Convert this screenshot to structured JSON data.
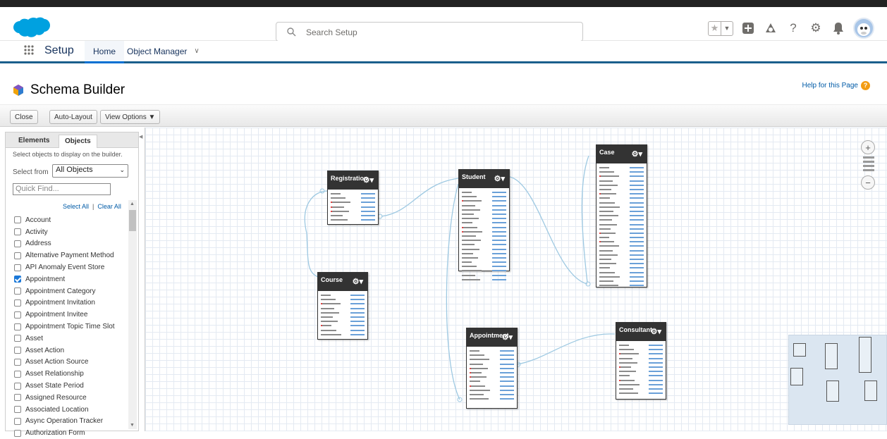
{
  "header": {
    "search_placeholder": "Search Setup"
  },
  "nav": {
    "app_name": "Setup",
    "tabs": [
      {
        "label": "Home"
      },
      {
        "label": "Object Manager"
      }
    ]
  },
  "page": {
    "title": "Schema Builder",
    "help_link": "Help for this Page"
  },
  "toolbar": {
    "close": "Close",
    "auto_layout": "Auto-Layout",
    "view_options": "View Options ▼"
  },
  "sidebar": {
    "tabs": [
      "Elements",
      "Objects"
    ],
    "hint": "Select objects to display on the builder.",
    "select_from_label": "Select from",
    "select_from_value": "All Objects",
    "quick_find_placeholder": "Quick Find...",
    "select_all": "Select All",
    "clear_all": "Clear All",
    "objects": [
      {
        "label": "Account",
        "checked": false
      },
      {
        "label": "Activity",
        "checked": false
      },
      {
        "label": "Address",
        "checked": false
      },
      {
        "label": "Alternative Payment Method",
        "checked": false
      },
      {
        "label": "API Anomaly Event Store",
        "checked": false
      },
      {
        "label": "Appointment",
        "checked": true
      },
      {
        "label": "Appointment Category",
        "checked": false
      },
      {
        "label": "Appointment Invitation",
        "checked": false
      },
      {
        "label": "Appointment Invitee",
        "checked": false
      },
      {
        "label": "Appointment Topic Time Slot",
        "checked": false
      },
      {
        "label": "Asset",
        "checked": false
      },
      {
        "label": "Asset Action",
        "checked": false
      },
      {
        "label": "Asset Action Source",
        "checked": false
      },
      {
        "label": "Asset Relationship",
        "checked": false
      },
      {
        "label": "Asset State Period",
        "checked": false
      },
      {
        "label": "Assigned Resource",
        "checked": false
      },
      {
        "label": "Associated Location",
        "checked": false
      },
      {
        "label": "Async Operation Tracker",
        "checked": false
      },
      {
        "label": "Authorization Form",
        "checked": false
      }
    ]
  },
  "schema_objects": [
    {
      "name": "Registration",
      "fields": 7
    },
    {
      "name": "Course",
      "fields": 10
    },
    {
      "name": "Student",
      "fields": 21
    },
    {
      "name": "Case",
      "fields": 28
    },
    {
      "name": "Appointment",
      "fields": 12
    },
    {
      "name": "Consultant",
      "fields": 12
    }
  ]
}
